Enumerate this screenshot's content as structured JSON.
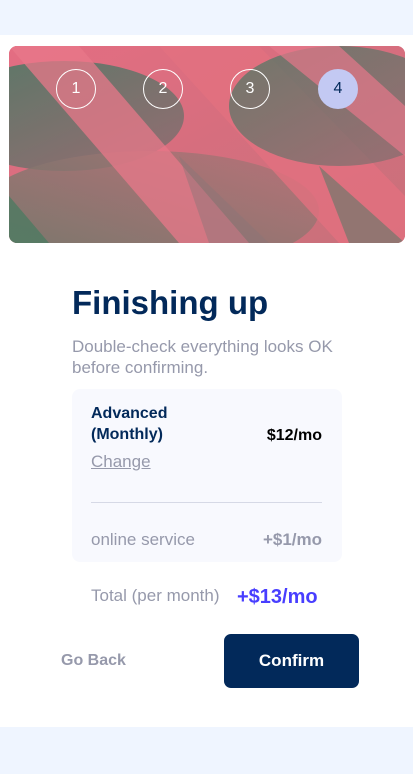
{
  "stepper": {
    "steps": [
      "1",
      "2",
      "3",
      "4"
    ],
    "active_step": "4"
  },
  "header": {
    "title": "Finishing up",
    "subtitle": "Double-check everything looks OK before confirming."
  },
  "summary": {
    "plan_name": "Advanced (Monthly)",
    "plan_price": "$12/mo",
    "change_label": "Change",
    "addons": [
      {
        "name": "online service",
        "price": "+$1/mo"
      }
    ]
  },
  "total": {
    "label": "Total (per month)",
    "price": "+$13/mo"
  },
  "actions": {
    "back_label": "Go Back",
    "confirm_label": "Confirm"
  },
  "colors": {
    "marine_blue": "#02295a",
    "purplish_blue": "#483eff",
    "cool_gray": "#9699ab",
    "light_gray": "#d6d9e6",
    "magnolia": "#f8f9fe",
    "alabaster": "#eff5ff",
    "active_step_bg": "#c3c9f3"
  }
}
